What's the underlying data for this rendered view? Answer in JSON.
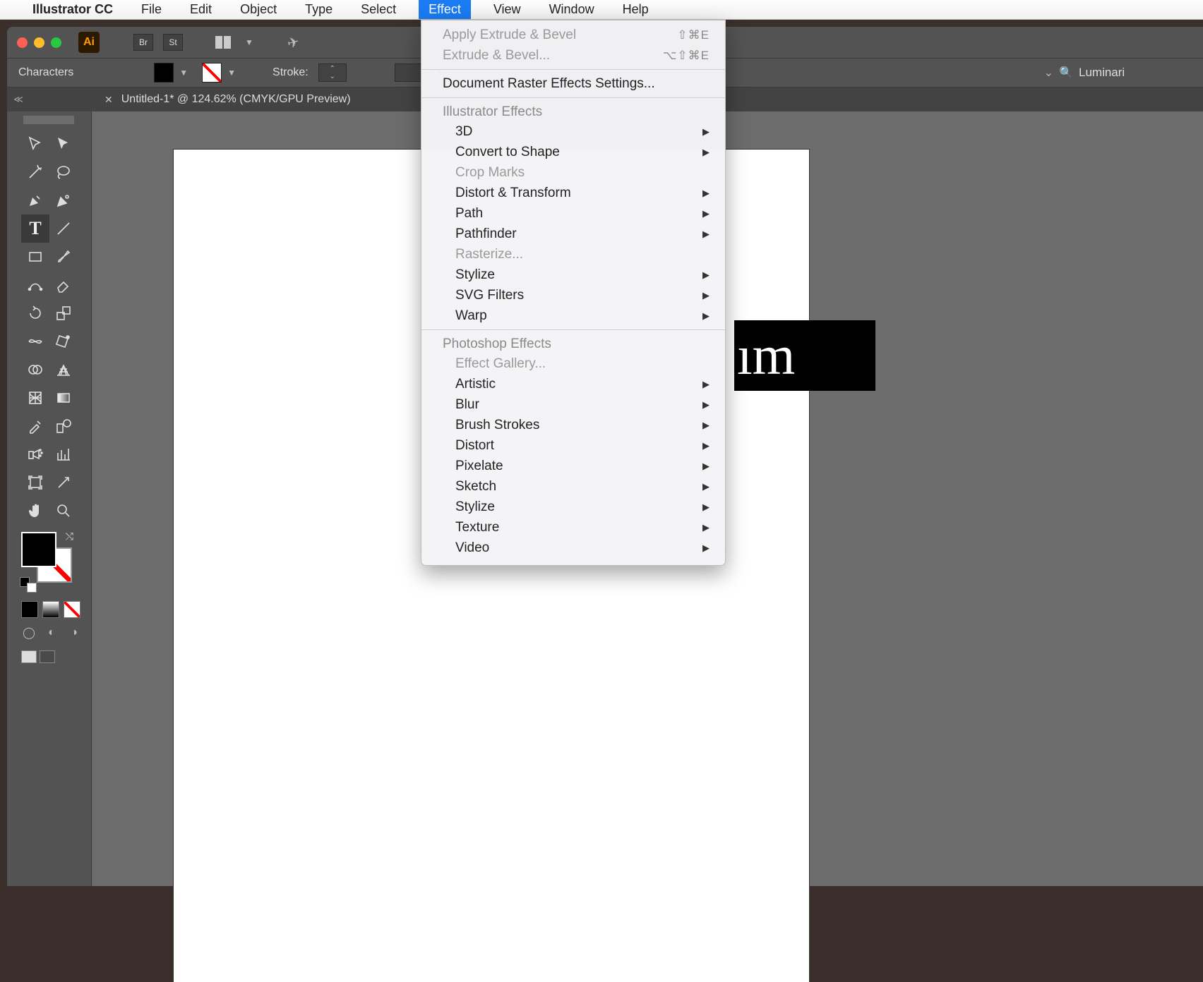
{
  "menubar": {
    "app": "Illustrator CC",
    "items": [
      "File",
      "Edit",
      "Object",
      "Type",
      "Select",
      "Effect",
      "View",
      "Window",
      "Help"
    ],
    "active": "Effect"
  },
  "titlebar": {
    "ai": "Ai",
    "br": "Br",
    "st": "St"
  },
  "controlbar": {
    "label": "Characters",
    "stroke_label": "Stroke:",
    "search_value": "Luminari"
  },
  "tab": {
    "title": "Untitled-1* @ 124.62% (CMYK/GPU Preview)"
  },
  "canvas": {
    "black_text": "ım"
  },
  "dropdown": {
    "apply": "Apply Extrude & Bevel",
    "apply_sc": "⇧⌘E",
    "last": "Extrude & Bevel...",
    "last_sc": "⌥⇧⌘E",
    "raster": "Document Raster Effects Settings...",
    "sec1": "Illustrator Effects",
    "ai_items": [
      {
        "label": "3D",
        "sub": true,
        "disabled": false
      },
      {
        "label": "Convert to Shape",
        "sub": true,
        "disabled": false
      },
      {
        "label": "Crop Marks",
        "sub": false,
        "disabled": true
      },
      {
        "label": "Distort & Transform",
        "sub": true,
        "disabled": false
      },
      {
        "label": "Path",
        "sub": true,
        "disabled": false
      },
      {
        "label": "Pathfinder",
        "sub": true,
        "disabled": false
      },
      {
        "label": "Rasterize...",
        "sub": false,
        "disabled": true
      },
      {
        "label": "Stylize",
        "sub": true,
        "disabled": false
      },
      {
        "label": "SVG Filters",
        "sub": true,
        "disabled": false
      },
      {
        "label": "Warp",
        "sub": true,
        "disabled": false
      }
    ],
    "sec2": "Photoshop Effects",
    "gallery": "Effect Gallery...",
    "ps_items": [
      {
        "label": "Artistic"
      },
      {
        "label": "Blur"
      },
      {
        "label": "Brush Strokes"
      },
      {
        "label": "Distort"
      },
      {
        "label": "Pixelate"
      },
      {
        "label": "Sketch"
      },
      {
        "label": "Stylize"
      },
      {
        "label": "Texture"
      },
      {
        "label": "Video"
      }
    ]
  }
}
